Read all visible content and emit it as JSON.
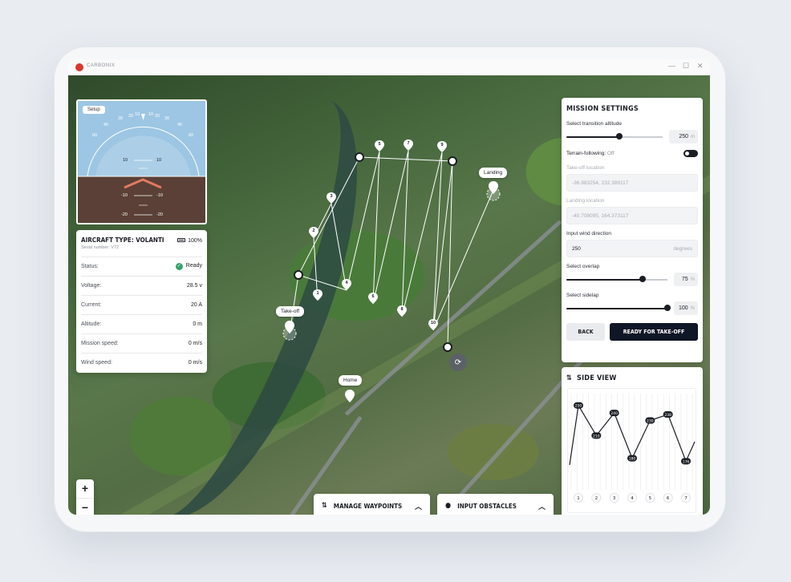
{
  "app": {
    "name": "CARBONIX"
  },
  "window": {
    "minimize": "—",
    "maximize": "☐",
    "close": "✕"
  },
  "attitude": {
    "setup_label": "Setup",
    "roll_ticks": [
      "30",
      "20",
      "10",
      "10",
      "20",
      "30"
    ],
    "roll_outer": [
      "60",
      "45",
      "45",
      "60"
    ],
    "pitch_labels": [
      "10",
      "10",
      "-10",
      "-10",
      "-20",
      "-20"
    ]
  },
  "aircraft": {
    "title": "AIRCRAFT TYPE: VOLANTI",
    "serial": "Serial number: V72",
    "battery": "100%",
    "rows": [
      {
        "label": "Status:",
        "value": "Ready"
      },
      {
        "label": "Voltage:",
        "value": "28.5 v"
      },
      {
        "label": "Current:",
        "value": "20 A"
      },
      {
        "label": "Altitude:",
        "value": "0 m"
      },
      {
        "label": "Mission speed:",
        "value": "0 m/s"
      },
      {
        "label": "Wind speed:",
        "value": "0 m/s"
      }
    ]
  },
  "zoom": {
    "in": "+",
    "out": "−"
  },
  "map": {
    "takeoff_label": "Take-off",
    "landing_label": "Landing",
    "home_label": "Home",
    "waypoints": [
      "1",
      "2",
      "3",
      "4",
      "5",
      "6",
      "7",
      "8",
      "9",
      "10"
    ]
  },
  "bottom": {
    "manage_waypoints": "MANAGE WAYPOINTS",
    "input_obstacles": "INPUT OBSTACLES"
  },
  "mission": {
    "title": "MISSION SETTINGS",
    "transition_label": "Select transition altitude",
    "transition_value": "250",
    "transition_unit": "m",
    "transition_fraction": 0.55,
    "terrain_label": "Terrain-following:",
    "terrain_state": "Off",
    "takeoff_location_label": "Take-off location",
    "takeoff_location_value": "-36.983254, 232.389117",
    "landing_location_label": "Landing location",
    "landing_location_value": "-40.708095, 164.373117",
    "wind_label": "Input wind direction",
    "wind_value": "250",
    "wind_unit": "degrees",
    "overlap_label": "Select overlap",
    "overlap_value": "75",
    "overlap_unit": "%",
    "overlap_fraction": 0.75,
    "sidelap_label": "Select sidelap",
    "sidelap_value": "100",
    "sidelap_unit": "%",
    "sidelap_fraction": 1.0,
    "back_label": "BACK",
    "ready_label": "READY FOR TAKE-OFF"
  },
  "sideview": {
    "title": "SIDE VIEW",
    "chart_data": {
      "type": "line",
      "x": [
        "1",
        "2",
        "3",
        "4",
        "5",
        "6",
        "7"
      ],
      "point_labels": [
        "250",
        "210",
        "240",
        "180",
        "230",
        "238",
        "176"
      ],
      "values": [
        250,
        210,
        240,
        180,
        230,
        238,
        176
      ]
    }
  }
}
